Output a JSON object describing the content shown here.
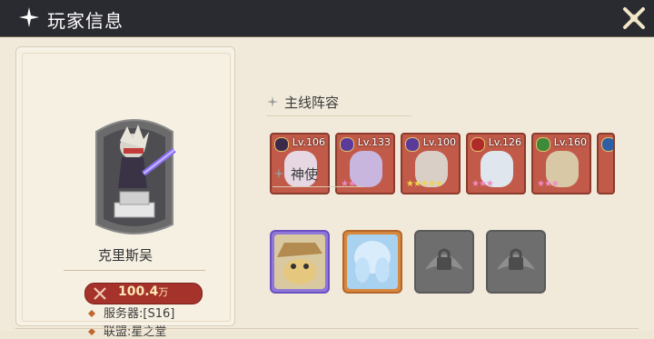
{
  "window": {
    "title": "玩家信息",
    "title_icon": "sparkle-icon",
    "close_icon": "close-icon"
  },
  "player": {
    "name": "克里斯吴",
    "power_value": "100.4",
    "power_unit": "万",
    "server": "服务器:[S16]",
    "alliance": "联盟:星之堂"
  },
  "main_lineup": {
    "heading": "主线阵容",
    "heroes": [
      {
        "level": "Lv.106",
        "stars": "",
        "star_color": "none",
        "element": "dark"
      },
      {
        "level": "Lv.133",
        "stars": "★★",
        "star_color": "pink",
        "element": "void"
      },
      {
        "level": "Lv.100",
        "stars": "★★★★★",
        "star_color": "gold",
        "element": "void"
      },
      {
        "level": "Lv.126",
        "stars": "★★★",
        "star_color": "pink",
        "element": "fire"
      },
      {
        "level": "Lv.160",
        "stars": "★★★",
        "star_color": "pink",
        "element": "nature"
      }
    ]
  },
  "envoys": {
    "heading": "神使",
    "items": [
      {
        "state": "unlocked",
        "icon": "scarecrow-envoy-icon"
      },
      {
        "state": "unlocked",
        "icon": "ice-spirit-envoy-icon"
      },
      {
        "state": "locked",
        "icon": "lock-icon"
      },
      {
        "state": "locked",
        "icon": "lock-icon"
      }
    ]
  },
  "colors": {
    "titlebar": "#2a2a31",
    "background": "#f1eadb",
    "power_badge": "#a5322b",
    "hero_card": "#c15a48",
    "envoy_border_purple": "#8b6fd0",
    "envoy_border_orange": "#d88b3a"
  }
}
